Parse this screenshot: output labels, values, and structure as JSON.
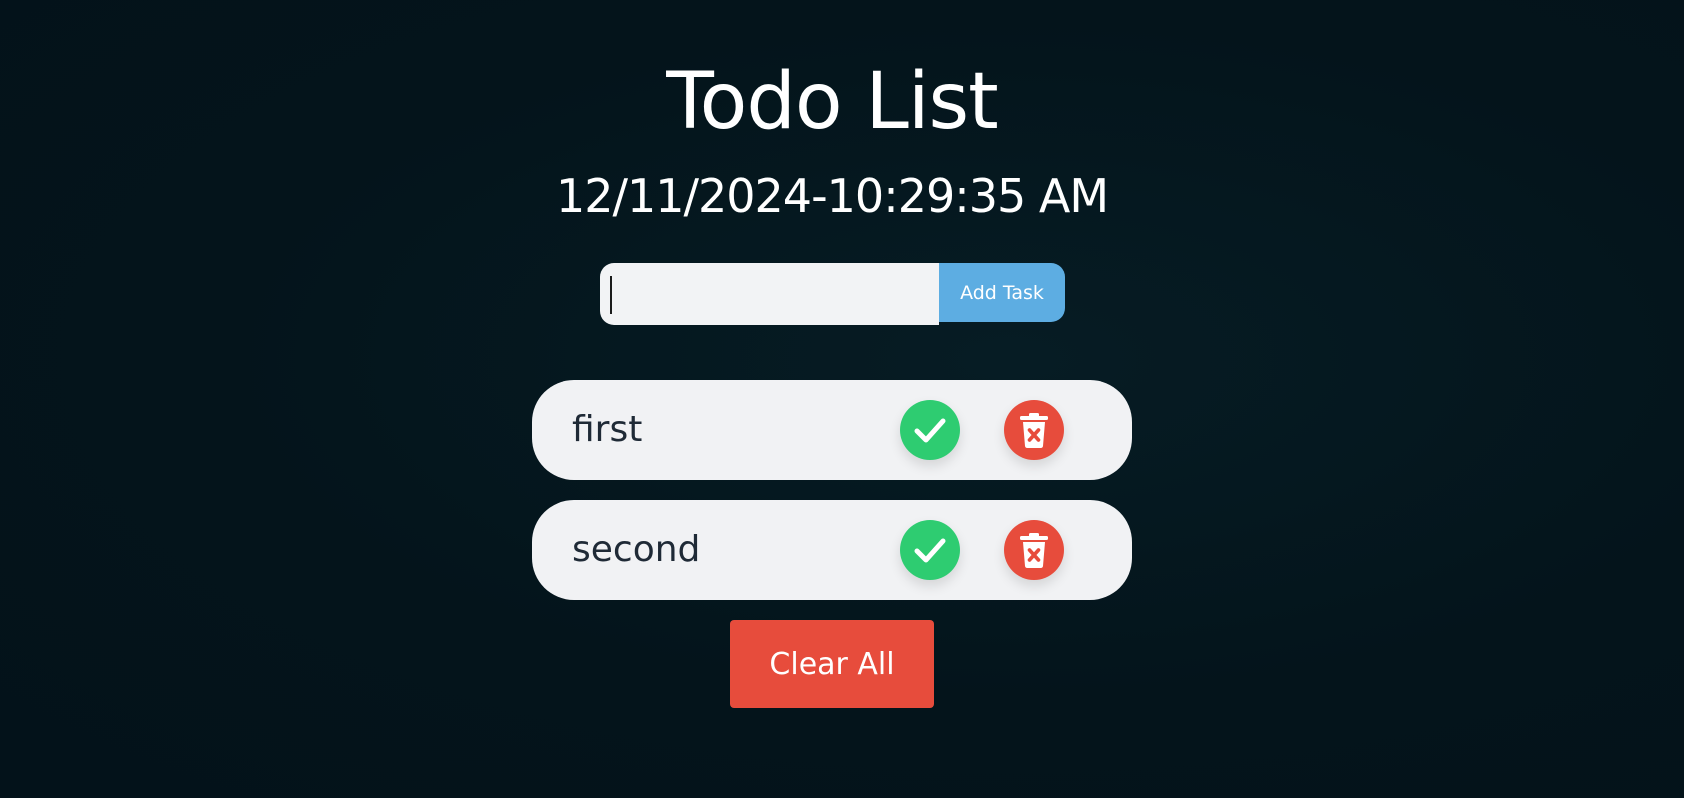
{
  "app": {
    "title": "Todo List",
    "datetime": "12/11/2024-10:29:35 AM"
  },
  "form": {
    "input_value": "",
    "input_placeholder": "",
    "add_button_label": "Add Task"
  },
  "tasks": [
    {
      "text": "first",
      "check_icon": "check-icon",
      "delete_icon": "trash-icon"
    },
    {
      "text": "second",
      "check_icon": "check-icon",
      "delete_icon": "trash-icon"
    }
  ],
  "actions": {
    "clear_all_label": "Clear All"
  },
  "colors": {
    "background": "#04161d",
    "accent_blue": "#5dade2",
    "complete_green": "#2ecc71",
    "delete_red": "#e74c3c",
    "item_background": "#f1f2f4"
  }
}
